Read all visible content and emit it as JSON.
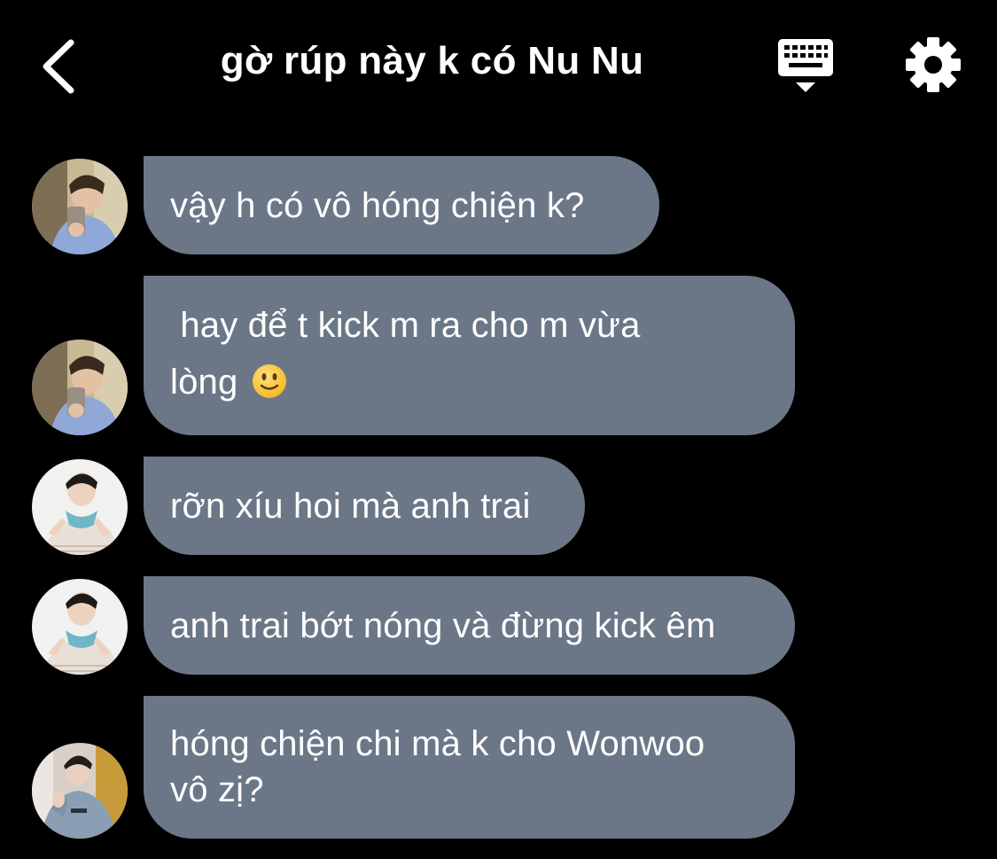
{
  "header": {
    "title": "gờ rúp này k có Nu Nu",
    "back_icon": "chevron-left-icon",
    "keyboard_icon": "keyboard-icon",
    "settings_icon": "gear-icon"
  },
  "messages": [
    {
      "text": "vậy h có vô hóng chiện k?",
      "sender_avatar": "avatar-mirror-selfie"
    },
    {
      "line1": " hay để t kick m ra cho m vừa",
      "line2": "lòng",
      "emoji": "slightly-smiling-face-icon",
      "sender_avatar": "avatar-mirror-selfie"
    },
    {
      "text": "rỡn xíu hoi mà anh trai",
      "sender_avatar": "avatar-scarf-hands"
    },
    {
      "text": "anh trai bớt nóng và đừng kick êm",
      "sender_avatar": "avatar-scarf-hands"
    },
    {
      "line1": "hóng chiện chi mà k cho Wonwoo",
      "line2": "vô zị?",
      "sender_avatar": "avatar-hoodie"
    }
  ],
  "colors": {
    "background": "#000000",
    "bubble": "#6b7787",
    "text": "#ffffff"
  }
}
